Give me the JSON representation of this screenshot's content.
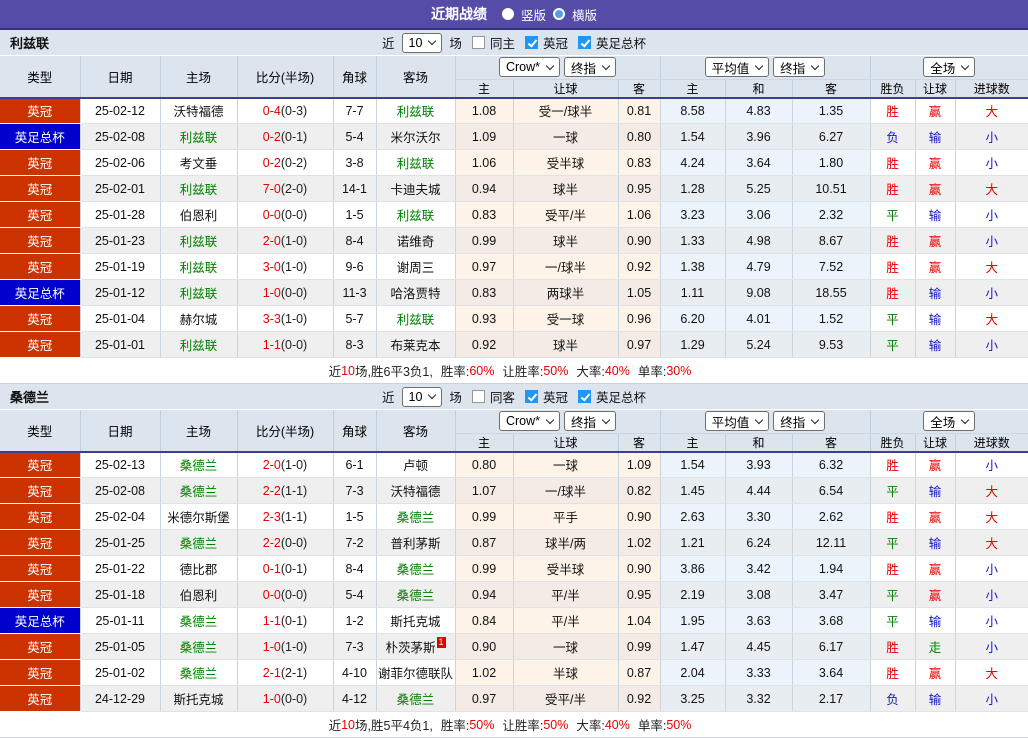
{
  "topbar": {
    "title": "近期战绩",
    "vertical_label": "竖版",
    "horizontal_label": "横版",
    "vertical_selected": true,
    "horizontal_selected": false
  },
  "controls": {
    "near_label": "近",
    "near_value": "10",
    "matches_label": "场",
    "league_label": "英冠",
    "cup_label": "英足总杯"
  },
  "columns": {
    "type": "类型",
    "date": "日期",
    "home": "主场",
    "score": "比分(半场)",
    "corner": "角球",
    "away": "客场",
    "book_select": "Crow*",
    "book_final_select": "终指",
    "avg_select": "平均值",
    "avg_final_select": "终指",
    "scope_select": "全场",
    "g1_home": "主",
    "g1_line": "让球",
    "g1_away": "客",
    "g2_home": "主",
    "g2_draw": "和",
    "g2_away": "客",
    "g3_outcome": "胜负",
    "g3_line": "让球",
    "g3_goals": "进球数"
  },
  "colors": {
    "topbar": "#544ca6",
    "league_badge": "#cc3300",
    "cup_badge": "#0000cc",
    "team_highlight": "#008000",
    "red": "#e60000",
    "green": "#008000",
    "blue": "#1414cc"
  },
  "sections": [
    {
      "team": "利兹联",
      "same_label": "同主",
      "filters": {
        "same": false,
        "league": true,
        "cup": true
      },
      "rows": [
        {
          "type": "英冠",
          "cup": false,
          "date": "25-02-12",
          "home": "沃特福德",
          "home_hl": false,
          "score_ft": "0-4",
          "score_ht": "(0-3)",
          "corner": "7-7",
          "away": "利兹联",
          "away_hl": true,
          "away_sup": null,
          "odds_home": "1.08",
          "odds_line": "受一/球半",
          "odds_away": "0.81",
          "avg_home": "8.58",
          "avg_draw": "4.83",
          "avg_away": "1.35",
          "res_outcome": "胜",
          "res_line": "赢",
          "res_goals": "大"
        },
        {
          "type": "英足总杯",
          "cup": true,
          "date": "25-02-08",
          "home": "利兹联",
          "home_hl": true,
          "score_ft": "0-2",
          "score_ht": "(0-1)",
          "corner": "5-4",
          "away": "米尔沃尔",
          "away_hl": false,
          "away_sup": null,
          "odds_home": "1.09",
          "odds_line": "一球",
          "odds_away": "0.80",
          "avg_home": "1.54",
          "avg_draw": "3.96",
          "avg_away": "6.27",
          "res_outcome": "负",
          "res_line": "输",
          "res_goals": "小"
        },
        {
          "type": "英冠",
          "cup": false,
          "date": "25-02-06",
          "home": "考文垂",
          "home_hl": false,
          "score_ft": "0-2",
          "score_ht": "(0-2)",
          "corner": "3-8",
          "away": "利兹联",
          "away_hl": true,
          "away_sup": null,
          "odds_home": "1.06",
          "odds_line": "受半球",
          "odds_away": "0.83",
          "avg_home": "4.24",
          "avg_draw": "3.64",
          "avg_away": "1.80",
          "res_outcome": "胜",
          "res_line": "赢",
          "res_goals": "小"
        },
        {
          "type": "英冠",
          "cup": false,
          "date": "25-02-01",
          "home": "利兹联",
          "home_hl": true,
          "score_ft": "7-0",
          "score_ht": "(2-0)",
          "corner": "14-1",
          "away": "卡迪夫城",
          "away_hl": false,
          "away_sup": null,
          "odds_home": "0.94",
          "odds_line": "球半",
          "odds_away": "0.95",
          "avg_home": "1.28",
          "avg_draw": "5.25",
          "avg_away": "10.51",
          "res_outcome": "胜",
          "res_line": "赢",
          "res_goals": "大"
        },
        {
          "type": "英冠",
          "cup": false,
          "date": "25-01-28",
          "home": "伯恩利",
          "home_hl": false,
          "score_ft": "0-0",
          "score_ht": "(0-0)",
          "corner": "1-5",
          "away": "利兹联",
          "away_hl": true,
          "away_sup": null,
          "odds_home": "0.83",
          "odds_line": "受平/半",
          "odds_away": "1.06",
          "avg_home": "3.23",
          "avg_draw": "3.06",
          "avg_away": "2.32",
          "res_outcome": "平",
          "res_line": "输",
          "res_goals": "小"
        },
        {
          "type": "英冠",
          "cup": false,
          "date": "25-01-23",
          "home": "利兹联",
          "home_hl": true,
          "score_ft": "2-0",
          "score_ht": "(1-0)",
          "corner": "8-4",
          "away": "诺维奇",
          "away_hl": false,
          "away_sup": null,
          "odds_home": "0.99",
          "odds_line": "球半",
          "odds_away": "0.90",
          "avg_home": "1.33",
          "avg_draw": "4.98",
          "avg_away": "8.67",
          "res_outcome": "胜",
          "res_line": "赢",
          "res_goals": "小"
        },
        {
          "type": "英冠",
          "cup": false,
          "date": "25-01-19",
          "home": "利兹联",
          "home_hl": true,
          "score_ft": "3-0",
          "score_ht": "(1-0)",
          "corner": "9-6",
          "away": "谢周三",
          "away_hl": false,
          "away_sup": null,
          "odds_home": "0.97",
          "odds_line": "一/球半",
          "odds_away": "0.92",
          "avg_home": "1.38",
          "avg_draw": "4.79",
          "avg_away": "7.52",
          "res_outcome": "胜",
          "res_line": "赢",
          "res_goals": "大"
        },
        {
          "type": "英足总杯",
          "cup": true,
          "date": "25-01-12",
          "home": "利兹联",
          "home_hl": true,
          "score_ft": "1-0",
          "score_ht": "(0-0)",
          "corner": "11-3",
          "away": "哈洛贾特",
          "away_hl": false,
          "away_sup": null,
          "odds_home": "0.83",
          "odds_line": "两球半",
          "odds_away": "1.05",
          "avg_home": "1.11",
          "avg_draw": "9.08",
          "avg_away": "18.55",
          "res_outcome": "胜",
          "res_line": "输",
          "res_goals": "小"
        },
        {
          "type": "英冠",
          "cup": false,
          "date": "25-01-04",
          "home": "赫尔城",
          "home_hl": false,
          "score_ft": "3-3",
          "score_ht": "(1-0)",
          "corner": "5-7",
          "away": "利兹联",
          "away_hl": true,
          "away_sup": null,
          "odds_home": "0.93",
          "odds_line": "受一球",
          "odds_away": "0.96",
          "avg_home": "6.20",
          "avg_draw": "4.01",
          "avg_away": "1.52",
          "res_outcome": "平",
          "res_line": "输",
          "res_goals": "大"
        },
        {
          "type": "英冠",
          "cup": false,
          "date": "25-01-01",
          "home": "利兹联",
          "home_hl": true,
          "score_ft": "1-1",
          "score_ht": "(0-0)",
          "corner": "8-3",
          "away": "布莱克本",
          "away_hl": false,
          "away_sup": null,
          "odds_home": "0.92",
          "odds_line": "球半",
          "odds_away": "0.97",
          "avg_home": "1.29",
          "avg_draw": "5.24",
          "avg_away": "9.53",
          "res_outcome": "平",
          "res_line": "输",
          "res_goals": "小"
        }
      ],
      "summary": {
        "lead": "近",
        "num": "10",
        "rest": "场,胜6平3负1,",
        "stats": [
          {
            "label": "胜率:",
            "value": "60%"
          },
          {
            "label": "让胜率:",
            "value": "50%"
          },
          {
            "label": "大率:",
            "value": "40%"
          },
          {
            "label": "单率:",
            "value": "30%"
          }
        ]
      }
    },
    {
      "team": "桑德兰",
      "same_label": "同客",
      "filters": {
        "same": false,
        "league": true,
        "cup": true
      },
      "rows": [
        {
          "type": "英冠",
          "cup": false,
          "date": "25-02-13",
          "home": "桑德兰",
          "home_hl": true,
          "score_ft": "2-0",
          "score_ht": "(1-0)",
          "corner": "6-1",
          "away": "卢顿",
          "away_hl": false,
          "away_sup": null,
          "odds_home": "0.80",
          "odds_line": "一球",
          "odds_away": "1.09",
          "avg_home": "1.54",
          "avg_draw": "3.93",
          "avg_away": "6.32",
          "res_outcome": "胜",
          "res_line": "赢",
          "res_goals": "小"
        },
        {
          "type": "英冠",
          "cup": false,
          "date": "25-02-08",
          "home": "桑德兰",
          "home_hl": true,
          "score_ft": "2-2",
          "score_ht": "(1-1)",
          "corner": "7-3",
          "away": "沃特福德",
          "away_hl": false,
          "away_sup": null,
          "odds_home": "1.07",
          "odds_line": "一/球半",
          "odds_away": "0.82",
          "avg_home": "1.45",
          "avg_draw": "4.44",
          "avg_away": "6.54",
          "res_outcome": "平",
          "res_line": "输",
          "res_goals": "大"
        },
        {
          "type": "英冠",
          "cup": false,
          "date": "25-02-04",
          "home": "米德尔斯堡",
          "home_hl": false,
          "score_ft": "2-3",
          "score_ht": "(1-1)",
          "corner": "1-5",
          "away": "桑德兰",
          "away_hl": true,
          "away_sup": null,
          "odds_home": "0.99",
          "odds_line": "平手",
          "odds_away": "0.90",
          "avg_home": "2.63",
          "avg_draw": "3.30",
          "avg_away": "2.62",
          "res_outcome": "胜",
          "res_line": "赢",
          "res_goals": "大"
        },
        {
          "type": "英冠",
          "cup": false,
          "date": "25-01-25",
          "home": "桑德兰",
          "home_hl": true,
          "score_ft": "2-2",
          "score_ht": "(0-0)",
          "corner": "7-2",
          "away": "普利茅斯",
          "away_hl": false,
          "away_sup": null,
          "odds_home": "0.87",
          "odds_line": "球半/两",
          "odds_away": "1.02",
          "avg_home": "1.21",
          "avg_draw": "6.24",
          "avg_away": "12.11",
          "res_outcome": "平",
          "res_line": "输",
          "res_goals": "大"
        },
        {
          "type": "英冠",
          "cup": false,
          "date": "25-01-22",
          "home": "德比郡",
          "home_hl": false,
          "score_ft": "0-1",
          "score_ht": "(0-1)",
          "corner": "8-4",
          "away": "桑德兰",
          "away_hl": true,
          "away_sup": null,
          "odds_home": "0.99",
          "odds_line": "受半球",
          "odds_away": "0.90",
          "avg_home": "3.86",
          "avg_draw": "3.42",
          "avg_away": "1.94",
          "res_outcome": "胜",
          "res_line": "赢",
          "res_goals": "小"
        },
        {
          "type": "英冠",
          "cup": false,
          "date": "25-01-18",
          "home": "伯恩利",
          "home_hl": false,
          "score_ft": "0-0",
          "score_ht": "(0-0)",
          "corner": "5-4",
          "away": "桑德兰",
          "away_hl": true,
          "away_sup": null,
          "odds_home": "0.94",
          "odds_line": "平/半",
          "odds_away": "0.95",
          "avg_home": "2.19",
          "avg_draw": "3.08",
          "avg_away": "3.47",
          "res_outcome": "平",
          "res_line": "赢",
          "res_goals": "小"
        },
        {
          "type": "英足总杯",
          "cup": true,
          "date": "25-01-11",
          "home": "桑德兰",
          "home_hl": true,
          "score_ft": "1-1",
          "score_ht": "(0-1)",
          "corner": "1-2",
          "away": "斯托克城",
          "away_hl": false,
          "away_sup": null,
          "odds_home": "0.84",
          "odds_line": "平/半",
          "odds_away": "1.04",
          "avg_home": "1.95",
          "avg_draw": "3.63",
          "avg_away": "3.68",
          "res_outcome": "平",
          "res_line": "输",
          "res_goals": "小"
        },
        {
          "type": "英冠",
          "cup": false,
          "date": "25-01-05",
          "home": "桑德兰",
          "home_hl": true,
          "score_ft": "1-0",
          "score_ht": "(1-0)",
          "corner": "7-3",
          "away": "朴茨茅斯",
          "away_hl": false,
          "away_sup": "1",
          "odds_home": "0.90",
          "odds_line": "一球",
          "odds_away": "0.99",
          "avg_home": "1.47",
          "avg_draw": "4.45",
          "avg_away": "6.17",
          "res_outcome": "胜",
          "res_line": "走",
          "res_goals": "小"
        },
        {
          "type": "英冠",
          "cup": false,
          "date": "25-01-02",
          "home": "桑德兰",
          "home_hl": true,
          "score_ft": "2-1",
          "score_ht": "(2-1)",
          "corner": "4-10",
          "away": "谢菲尔德联队",
          "away_hl": false,
          "away_sup": null,
          "odds_home": "1.02",
          "odds_line": "半球",
          "odds_away": "0.87",
          "avg_home": "2.04",
          "avg_draw": "3.33",
          "avg_away": "3.64",
          "res_outcome": "胜",
          "res_line": "赢",
          "res_goals": "大"
        },
        {
          "type": "英冠",
          "cup": false,
          "date": "24-12-29",
          "home": "斯托克城",
          "home_hl": false,
          "score_ft": "1-0",
          "score_ht": "(0-0)",
          "corner": "4-12",
          "away": "桑德兰",
          "away_hl": true,
          "away_sup": null,
          "odds_home": "0.97",
          "odds_line": "受平/半",
          "odds_away": "0.92",
          "avg_home": "3.25",
          "avg_draw": "3.32",
          "avg_away": "2.17",
          "res_outcome": "负",
          "res_line": "输",
          "res_goals": "小"
        }
      ],
      "summary": {
        "lead": "近",
        "num": "10",
        "rest": "场,胜5平4负1,",
        "stats": [
          {
            "label": "胜率:",
            "value": "50%"
          },
          {
            "label": "让胜率:",
            "value": "50%"
          },
          {
            "label": "大率:",
            "value": "40%"
          },
          {
            "label": "单率:",
            "value": "50%"
          }
        ]
      }
    }
  ]
}
